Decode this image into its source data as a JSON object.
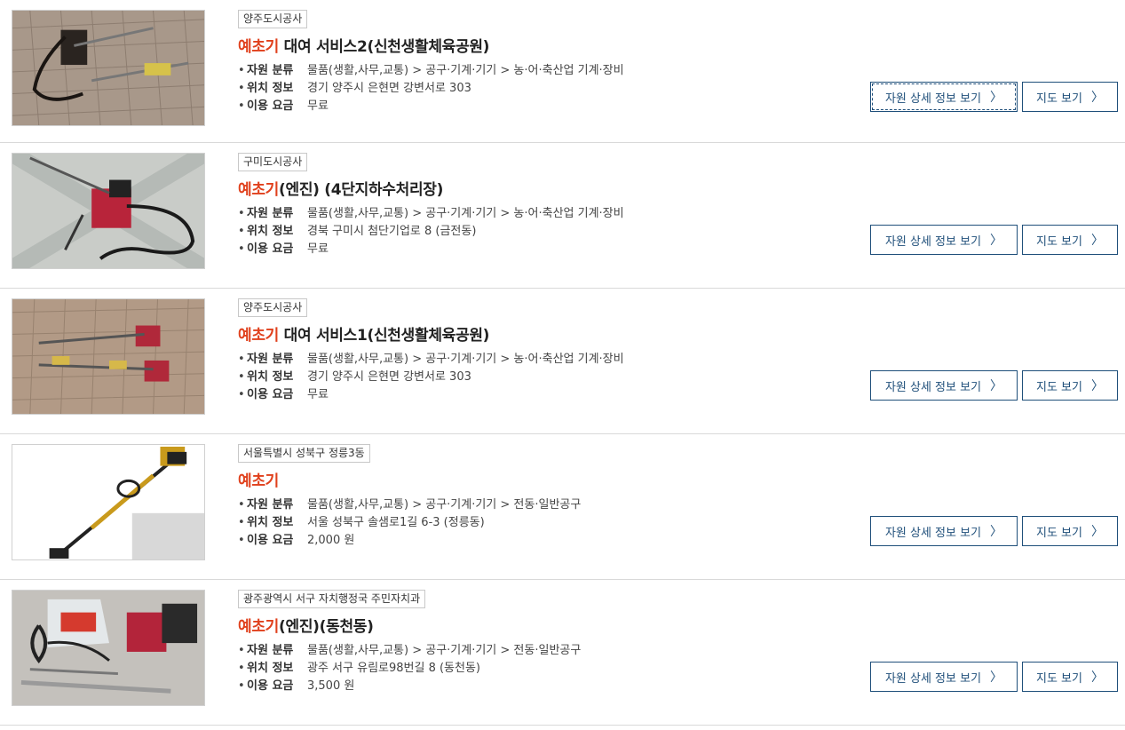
{
  "labels": {
    "category": "자원 분류",
    "location": "위치 정보",
    "fee": "이용 요금",
    "detail_button": "자원 상세 정보 보기",
    "map_button": "지도 보기",
    "chevron": "〉"
  },
  "colors": {
    "highlight": "#e0401c",
    "button_border": "#1f4f7a"
  },
  "items": [
    {
      "agency": "양주도시공사",
      "title_hl": "예초기",
      "title_rest": " 대여 서비스2(신천생활체육공원)",
      "category": "물품(생활,사무,교통) > 공구·기계·기기 > 농·어·축산업 기계·장비",
      "location": "경기 양주시 은현면 강변서로 303",
      "fee": "무료"
    },
    {
      "agency": "구미도시공사",
      "title_hl": "예초기",
      "title_rest": "(엔진) (4단지하수처리장)",
      "category": "물품(생활,사무,교통) > 공구·기계·기기 > 농·어·축산업 기계·장비",
      "location": "경북 구미시 첨단기업로 8 (금전동)",
      "fee": "무료"
    },
    {
      "agency": "양주도시공사",
      "title_hl": "예초기",
      "title_rest": " 대여 서비스1(신천생활체육공원)",
      "category": "물품(생활,사무,교통) > 공구·기계·기기 > 농·어·축산업 기계·장비",
      "location": "경기 양주시 은현면 강변서로 303",
      "fee": "무료"
    },
    {
      "agency": "서울특별시 성북구 정릉3동",
      "title_hl": "예초기",
      "title_rest": "",
      "category": "물품(생활,사무,교통) > 공구·기계·기기 > 전동·일반공구",
      "location": "서울 성북구 솔샘로1길 6-3 (정릉동)",
      "fee": "2,000 원"
    },
    {
      "agency": "광주광역시 서구 자치행정국 주민자치과",
      "title_hl": "예초기",
      "title_rest": "(엔진)(동천동)",
      "category": "물품(생활,사무,교통) > 공구·기계·기기 > 전동·일반공구",
      "location": "광주 서구 유림로98번길 8 (동천동)",
      "fee": "3,500 원"
    }
  ]
}
